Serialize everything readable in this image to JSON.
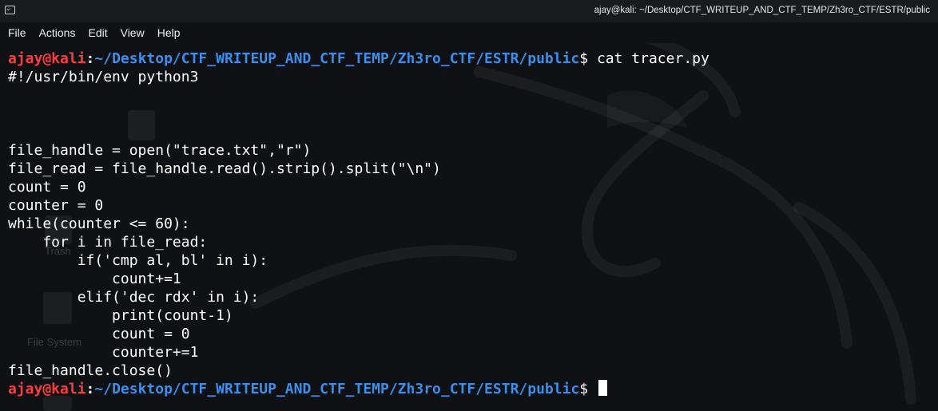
{
  "window": {
    "title": "ajay@kali: ~/Desktop/CTF_WRITEUP_AND_CTF_TEMP/Zh3ro_CTF/ESTR/public"
  },
  "menu": {
    "items": [
      "File",
      "Actions",
      "Edit",
      "View",
      "Help"
    ]
  },
  "desktop_ghost_labels": {
    "trash": "Trash",
    "filesystem": "File System"
  },
  "prompt": {
    "user_host": "ajay@kali",
    "separator": ":",
    "path": "~/Desktop/CTF_WRITEUP_AND_CTF_TEMP/Zh3ro_CTF/ESTR/public",
    "symbol": "$"
  },
  "command": " cat tracer.py",
  "output_lines": [
    "#!/usr/bin/env python3",
    "",
    "",
    "",
    "file_handle = open(\"trace.txt\",\"r\")",
    "file_read = file_handle.read().strip().split(\"\\n\")",
    "count = 0",
    "counter = 0",
    "while(counter <= 60):",
    "    for i in file_read:",
    "        if('cmp al, bl' in i):",
    "            count+=1",
    "        elif('dec rdx' in i):",
    "            print(count-1)",
    "            count = 0",
    "            counter+=1",
    "file_handle.close()"
  ],
  "colors": {
    "user_host": "#ff3b3b",
    "path": "#3b8eea",
    "background": "#101114",
    "text": "#ffffff"
  }
}
